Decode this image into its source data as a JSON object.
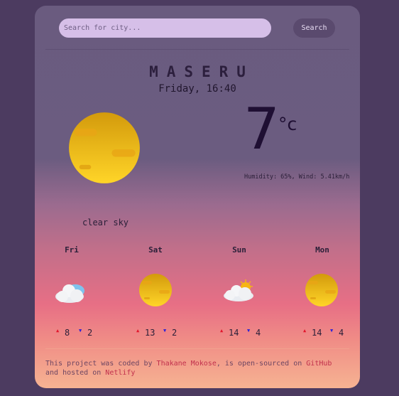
{
  "search": {
    "placeholder": "Search for city...",
    "button_label": "Search"
  },
  "current": {
    "city": "MASERU",
    "datetime": "Friday, 16:40",
    "temperature": "7",
    "unit": "°c",
    "details": "Humidity: 65%, Wind: 5.41km/h",
    "description": "clear sky",
    "icon": "sun-icon"
  },
  "forecast": [
    {
      "day": "Fri",
      "icon": "cloud-icon",
      "high": "8",
      "low": "2"
    },
    {
      "day": "Sat",
      "icon": "sun-icon",
      "high": "13",
      "low": "2"
    },
    {
      "day": "Sun",
      "icon": "partly-cloudy-icon",
      "high": "14",
      "low": "4"
    },
    {
      "day": "Mon",
      "icon": "sun-icon",
      "high": "14",
      "low": "4"
    }
  ],
  "arrows": {
    "up": "▲",
    "down": "▼"
  },
  "footer": {
    "text1": "This project was coded by ",
    "author": "Thakane Mokose",
    "text2": ", is open-sourced on ",
    "github": "GitHub",
    "text3": " and hosted on ",
    "netlify": "Netlify"
  },
  "colors": {
    "sun_light": "#ffd528",
    "sun_dark": "#d39a0c",
    "high_arrow": "#e2152b",
    "low_arrow": "#2a1fd8"
  }
}
